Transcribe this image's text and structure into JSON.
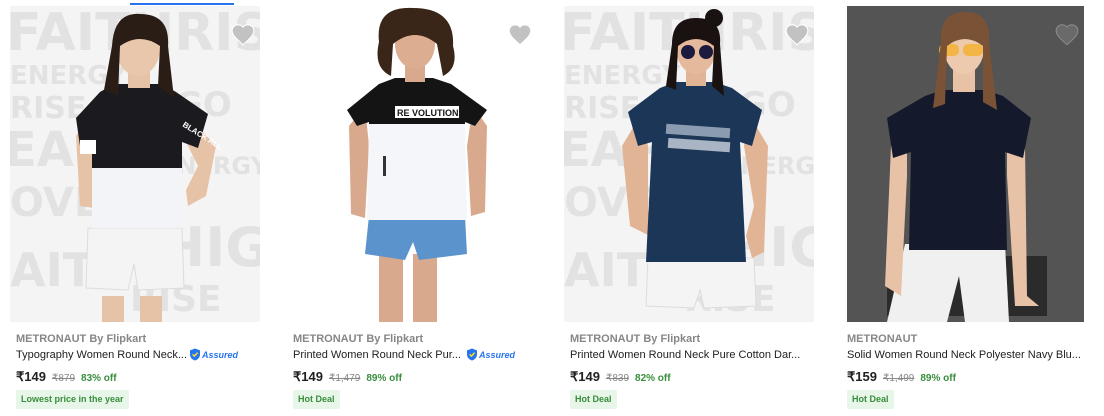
{
  "products": [
    {
      "brand": "METRONAUT By Flipkart",
      "title": "Typography Women Round Neck...",
      "assured": "Assured",
      "price": "₹149",
      "mrp": "₹879",
      "discount": "83% off",
      "badge": "Lowest price in the year",
      "print_text": "BLACK ALL"
    },
    {
      "brand": "METRONAUT By Flipkart",
      "title": "Printed Women Round Neck Pur...",
      "assured": "Assured",
      "price": "₹149",
      "mrp": "₹1,479",
      "discount": "89% off",
      "badge": "Hot Deal",
      "print_text": "RE VOLUTION"
    },
    {
      "brand": "METRONAUT By Flipkart",
      "title": "Printed Women Round Neck Pure Cotton Dar...",
      "price": "₹149",
      "mrp": "₹839",
      "discount": "82% off",
      "badge": "Hot Deal"
    },
    {
      "brand": "METRONAUT",
      "title": "Solid Women Round Neck Polyester Navy Blu...",
      "price": "₹159",
      "mrp": "₹1,499",
      "discount": "89% off",
      "badge": "Hot Deal"
    }
  ],
  "backdrop_words": [
    "FAITHRISE",
    "ENERGY",
    "RISE",
    "PGO",
    "EAP",
    "ENERGY",
    "HIGH",
    "OVE",
    "AITH",
    "RISE"
  ],
  "colors": {
    "accent": "#2874f0",
    "discount_green": "#388e3c",
    "badge_bg": "#e8f5e9",
    "wishlist_heart": "#c2c2c2"
  },
  "icons": [
    "heart-icon",
    "assured-shield-icon"
  ]
}
